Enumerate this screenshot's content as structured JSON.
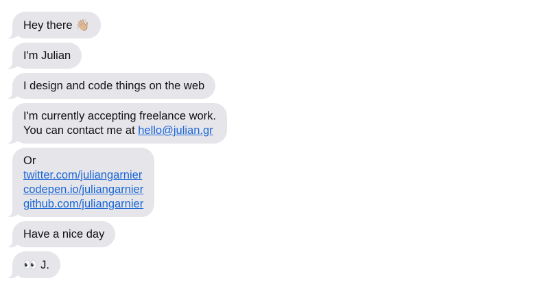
{
  "messages": {
    "greeting": {
      "text": "Hey there",
      "emoji": "👋🏼",
      "emoji_name": "waving-hand-icon"
    },
    "intro": {
      "text": "I'm Julian"
    },
    "role": {
      "text": "I design and code things on the web"
    },
    "freelance": {
      "line1": "I'm currently accepting freelance work.",
      "line2_prefix": "You can contact me at ",
      "email_label": "hello@julian.gr"
    },
    "links": {
      "heading": "Or",
      "twitter_label": "twitter.com/juliangarnier",
      "codepen_label": "codepen.io/juliangarnier",
      "github_label": "github.com/juliangarnier"
    },
    "farewell": {
      "text": "Have a nice day"
    },
    "signoff": {
      "emoji": "👀",
      "emoji_name": "eyes-icon",
      "text": "J."
    }
  },
  "colors": {
    "bubble": "#e5e5ea",
    "link": "#1a66d6",
    "text": "#111111",
    "background": "#ffffff"
  }
}
